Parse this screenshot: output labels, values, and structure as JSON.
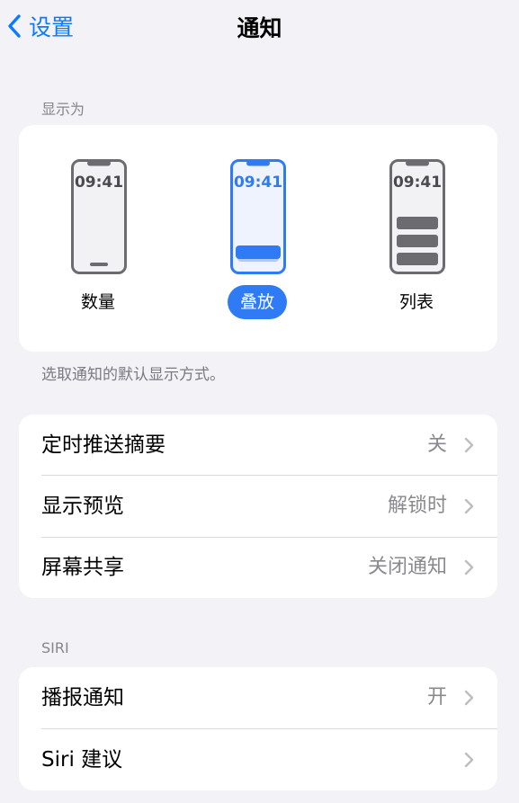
{
  "nav": {
    "back_label": "设置",
    "title": "通知"
  },
  "display_as": {
    "header": "显示为",
    "options": [
      {
        "label": "数量",
        "time": "09:41",
        "selected": false
      },
      {
        "label": "叠放",
        "time": "09:41",
        "selected": true
      },
      {
        "label": "列表",
        "time": "09:41",
        "selected": false
      }
    ],
    "footer": "选取通知的默认显示方式。"
  },
  "general": {
    "rows": [
      {
        "label": "定时推送摘要",
        "value": "关"
      },
      {
        "label": "显示预览",
        "value": "解锁时"
      },
      {
        "label": "屏幕共享",
        "value": "关闭通知"
      }
    ]
  },
  "siri": {
    "header": "SIRI",
    "rows": [
      {
        "label": "播报通知",
        "value": "开"
      },
      {
        "label": "Siri 建议",
        "value": ""
      }
    ]
  },
  "colors": {
    "accent": "#0A7AFF",
    "selected_fill": "#2F7BF5",
    "background": "#F2F2F7",
    "card": "#FFFFFF",
    "secondary_text": "#8A8A8E"
  },
  "icons": [
    "chevron-left-icon",
    "chevron-right-icon",
    "phone-count-icon",
    "phone-stack-icon",
    "phone-list-icon"
  ]
}
